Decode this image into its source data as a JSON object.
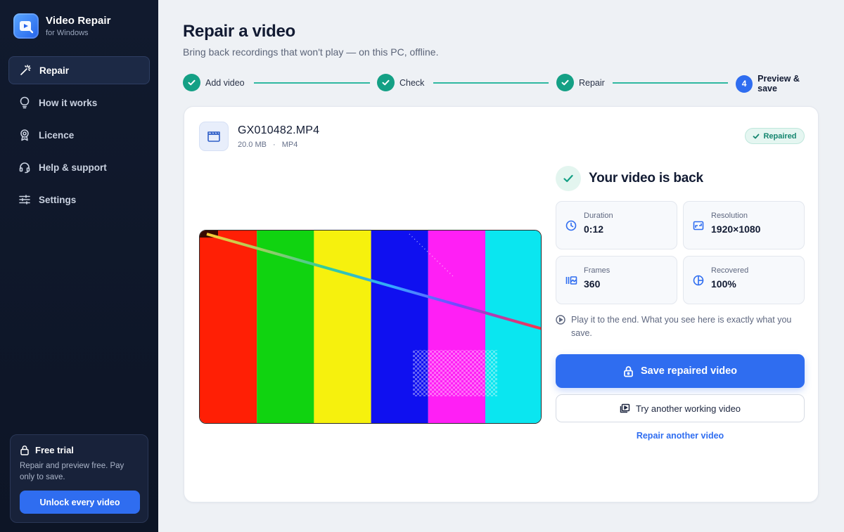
{
  "app": {
    "name": "Video Repair",
    "subtitle": "for Windows"
  },
  "sidebar": {
    "items": [
      {
        "label": "Repair",
        "icon": "magic-wand-icon",
        "active": true
      },
      {
        "label": "How it works",
        "icon": "lightbulb-icon",
        "active": false
      },
      {
        "label": "Licence",
        "icon": "award-icon",
        "active": false
      },
      {
        "label": "Help & support",
        "icon": "headset-icon",
        "active": false
      },
      {
        "label": "Settings",
        "icon": "sliders-icon",
        "active": false
      }
    ],
    "trial": {
      "title": "Free trial",
      "description": "Repair and preview free. Pay only to save.",
      "button": "Unlock every video"
    }
  },
  "header": {
    "title": "Repair a video",
    "subtitle": "Bring back recordings that won't play — on this PC, offline."
  },
  "stepper": {
    "steps": [
      {
        "label": "Add video",
        "status": "done"
      },
      {
        "label": "Check",
        "status": "done"
      },
      {
        "label": "Repair",
        "status": "done"
      },
      {
        "label": "Preview & save",
        "status": "current",
        "number": "4"
      }
    ]
  },
  "file": {
    "name": "GX010482.MP4",
    "size": "20.0 MB",
    "separator": "·",
    "format": "MP4",
    "badge": "Repaired"
  },
  "result": {
    "title": "Your video is back",
    "stats": [
      {
        "label": "Duration",
        "value": "0:12",
        "icon": "clock-icon"
      },
      {
        "label": "Resolution",
        "value": "1920×1080",
        "icon": "image-icon"
      },
      {
        "label": "Frames",
        "value": "360",
        "icon": "film-frames-icon"
      },
      {
        "label": "Recovered",
        "value": "100%",
        "icon": "pie-icon"
      }
    ],
    "note": "Play it to the end. What you see here is exactly what you save.",
    "save_button": "Save repaired video",
    "try_button": "Try another working video",
    "repair_link": "Repair another video"
  },
  "colors": {
    "accent": "#2f6df0",
    "success": "#14a085",
    "sidebar_bg": "#111a2e",
    "bars": [
      "#ff1f05",
      "#10d310",
      "#f6f10d",
      "#0f10f0",
      "#ff1ff5",
      "#0ae6f0"
    ]
  }
}
